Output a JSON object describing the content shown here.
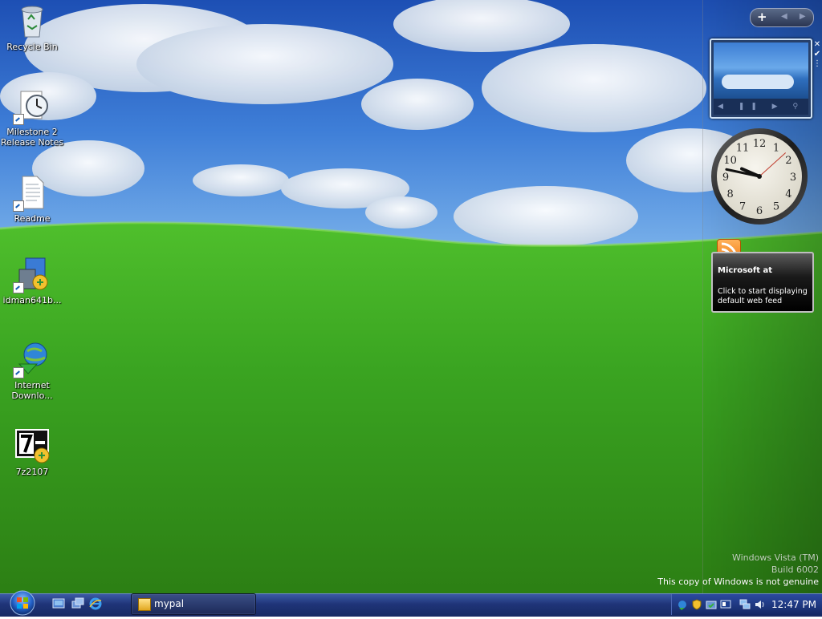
{
  "desktop": {
    "icons": [
      {
        "label_line1": "Recycle Bin",
        "label_line2": "",
        "icon": "recycle-bin-icon"
      },
      {
        "label_line1": "Milestone 2",
        "label_line2": "Release Notes",
        "icon": "clock-document-icon"
      },
      {
        "label_line1": "Readme",
        "label_line2": "",
        "icon": "text-document-icon"
      },
      {
        "label_line1": "idman641b...",
        "label_line2": "",
        "icon": "installer-icon"
      },
      {
        "label_line1": "Internet",
        "label_line2": "Downlo...",
        "icon": "internet-download-manager-icon"
      },
      {
        "label_line1": "7z2107",
        "label_line2": "",
        "icon": "seven-zip-installer-icon"
      }
    ]
  },
  "sidebar": {
    "add_label": "+",
    "nav_label": "◀ ▶",
    "close_glyph": "✕",
    "check_glyph": "✔",
    "feed": {
      "title": "Microsoft at",
      "body": "Click to start displaying default web feed"
    },
    "clock": {
      "hour": 9,
      "minute": 47,
      "second": 8
    }
  },
  "watermark": {
    "line1": "Windows Vista (TM)",
    "line2": "Build 6002",
    "line3": "This copy of Windows is not genuine"
  },
  "taskbar": {
    "task_label": "mypal",
    "time": "12:47 PM"
  }
}
